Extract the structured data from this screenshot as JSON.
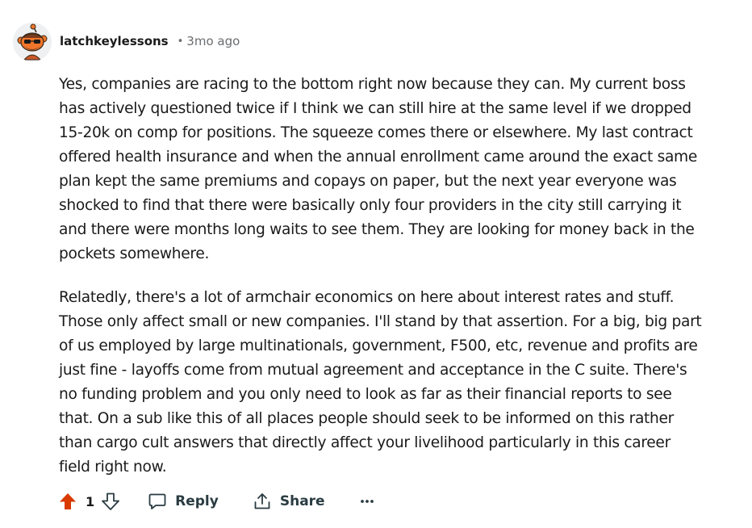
{
  "comment": {
    "author": "latchkeylessons",
    "separator": "•",
    "time": "3mo ago",
    "paragraphs": [
      "Yes, companies are racing to the bottom right now because they can. My current boss\nhas actively questioned twice if I think we can still hire at the same level if we dropped\n15-20k on comp for positions. The squeeze comes there or elsewhere. My last contract\noffered health insurance and when the annual enrollment came around the exact same\nplan kept the same premiums and copays on paper, but the next year everyone was\nshocked to find that there were basically only four providers in the city still carrying it\nand there were months long waits to see them. They are looking for money back in the\npockets somewhere.",
      "Relatedly, there's a lot of armchair economics on here about interest rates and stuff.\nThose only affect small or new companies. I'll stand by that assertion. For a big, big part\nof us employed by large multinationals, government, F500, etc, revenue and profits are\njust fine - layoffs come from mutual agreement and acceptance in the C suite. There's\nno funding problem and you only need to look as far as their financial reports to see\nthat. On a sub like this of all places people should seek to be informed on this rather\nthan cargo cult answers that directly affect your livelihood particularly in this career\nfield right now."
    ]
  },
  "actions": {
    "score": "1",
    "upvote_icon": "upvote-arrow-filled",
    "downvote_icon": "downvote-arrow-outline",
    "reply_label": "Reply",
    "reply_icon": "speech-bubble",
    "share_label": "Share",
    "share_icon": "share-arrow-up",
    "more_icon": "ellipsis",
    "upvote_color": "#d93a00"
  }
}
